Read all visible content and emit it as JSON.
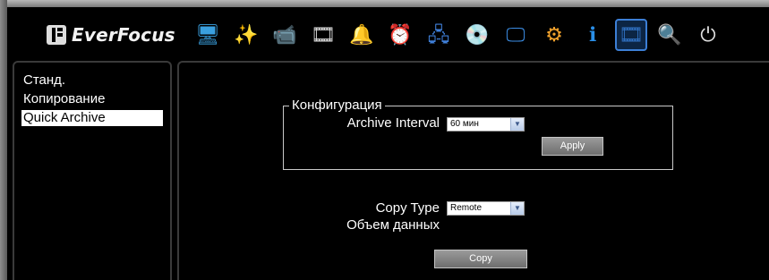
{
  "brand": {
    "logo_text": "EverFocus"
  },
  "toolbar": [
    {
      "name": "monitor-layout-icon",
      "glyph": "🖥",
      "color": "#3aa0e0"
    },
    {
      "name": "magic-wand-icon",
      "glyph": "✨",
      "color": "#e8d24a"
    },
    {
      "name": "camera-icon",
      "glyph": "📹",
      "color": "#cfcfcf"
    },
    {
      "name": "film-reel-icon",
      "glyph": "🎞",
      "color": "#d8d8d8"
    },
    {
      "name": "alarm-bell-icon",
      "glyph": "🔔",
      "color": "#f0b21e"
    },
    {
      "name": "schedule-clock-icon",
      "glyph": "⏰",
      "color": "#5fbf4f"
    },
    {
      "name": "network-icon",
      "glyph": "🖧",
      "color": "#3f7fd8"
    },
    {
      "name": "disk-icon",
      "glyph": "💿",
      "color": "#d19a3a"
    },
    {
      "name": "display-icon",
      "glyph": "🖵",
      "color": "#3c8ee6"
    },
    {
      "name": "settings-gears-icon",
      "glyph": "⚙",
      "color": "#f0a12c"
    },
    {
      "name": "info-icon",
      "glyph": "ℹ",
      "color": "#2a8fe8"
    },
    {
      "name": "backup-icon",
      "glyph": "🎞",
      "color": "#2f6fbf",
      "active": true
    },
    {
      "name": "log-search-icon",
      "glyph": "🔍",
      "color": "#d8d8d8"
    },
    {
      "name": "shutdown-icon",
      "glyph": "⏻",
      "color": "#e0e0e0"
    }
  ],
  "sidebar": {
    "items": [
      {
        "label": "Станд.",
        "name": "sidebar-item-standard"
      },
      {
        "label": "Копирование",
        "name": "sidebar-item-copy"
      },
      {
        "label": "Quick Archive",
        "name": "sidebar-item-quick-archive",
        "selected": true
      }
    ]
  },
  "config": {
    "legend": "Конфигурация",
    "archive_interval_label": "Archive Interval",
    "archive_interval_value": "60 мин",
    "apply_label": "Apply"
  },
  "copy": {
    "copy_type_label": "Copy Type",
    "copy_type_value": "Remote",
    "data_volume_label": "Объем данных",
    "copy_label": "Copy"
  }
}
